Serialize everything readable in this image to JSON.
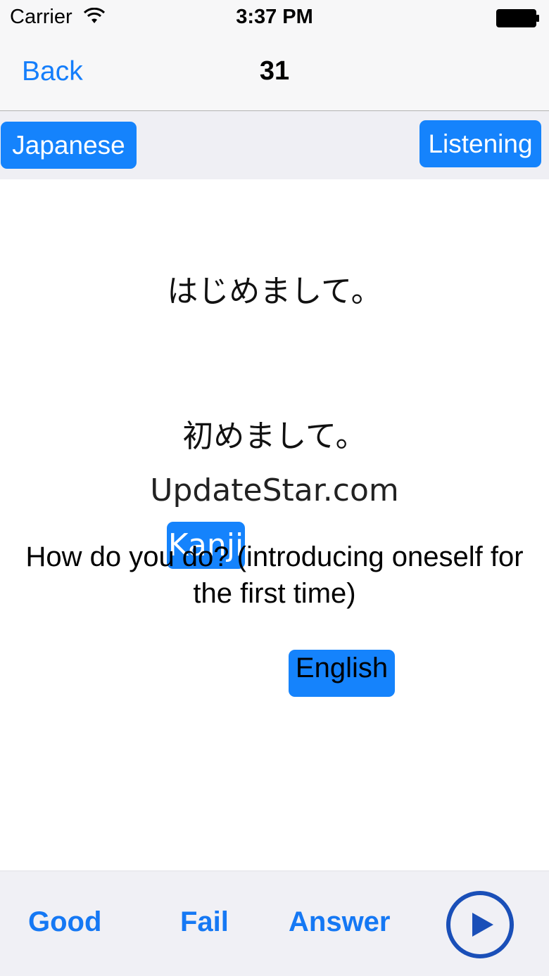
{
  "status_bar": {
    "carrier": "Carrier",
    "time": "3:37 PM",
    "wifi_icon": "wifi-icon",
    "battery_icon": "battery-icon"
  },
  "nav": {
    "back_label": "Back",
    "title": "31"
  },
  "modes": {
    "japanese": "Japanese",
    "kanji": "Kanji",
    "english": "English",
    "listening": "Listening"
  },
  "card": {
    "kana": "はじめまして。",
    "kanji": "初めまして。",
    "watermark": "UpdateStar.com",
    "english": "How do you do? (introducing oneself for the first time)"
  },
  "bottom": {
    "good": "Good",
    "fail": "Fail",
    "answer": "Answer",
    "play_icon": "play-icon"
  },
  "colors": {
    "accent": "#157efb",
    "button_bg": "#1583fc",
    "play_circle": "#1a4fb8"
  }
}
